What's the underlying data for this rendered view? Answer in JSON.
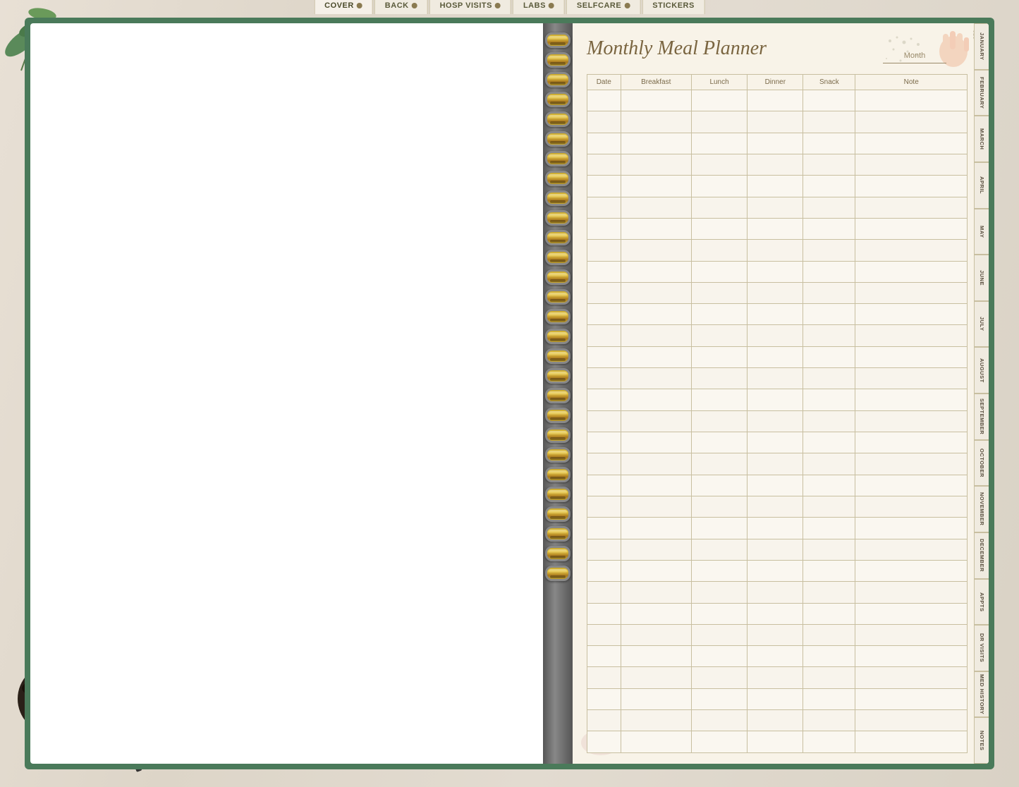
{
  "tabs": [
    {
      "label": "COVER",
      "active": true
    },
    {
      "label": "BACK",
      "active": false
    },
    {
      "label": "HOSP VISITS",
      "active": false
    },
    {
      "label": "LABS",
      "active": false
    },
    {
      "label": "SELFCARE",
      "active": false
    },
    {
      "label": "STICKERS",
      "active": false
    }
  ],
  "page": {
    "title": "Monthly Meal Planner",
    "month_label": "Month",
    "columns": [
      "Date",
      "Breakfast",
      "Lunch",
      "Dinner",
      "Snack",
      "Note"
    ],
    "row_count": 31
  },
  "months": [
    "JANUARY",
    "FEBRUARY",
    "MARCH",
    "APRIL",
    "MAY",
    "JUNE",
    "JULY",
    "AUGUST",
    "SEPTEMBER",
    "OCTOBER",
    "NOVEMBER",
    "DECEMBER",
    "APPTS",
    "DR VISITS",
    "MED HISTORY",
    "NOTES"
  ],
  "spiral_rings": 28
}
